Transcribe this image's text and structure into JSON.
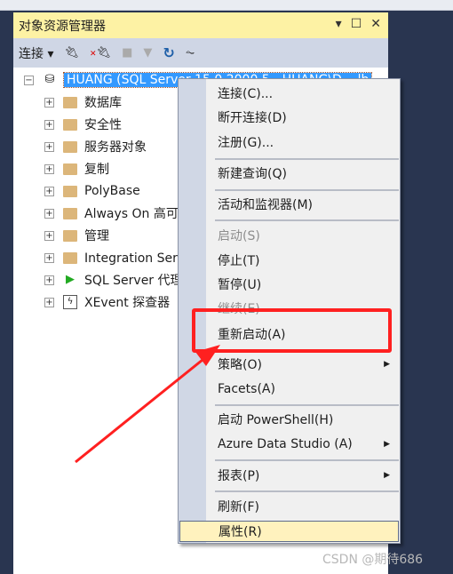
{
  "panel": {
    "title": "对象资源管理器",
    "controls": [
      "▾",
      "☐",
      "✕"
    ]
  },
  "toolbar": {
    "connect_label": "连接",
    "icons": [
      "plug-icon",
      "disconnect-icon",
      "stop-icon",
      "filter-icon",
      "refresh-icon",
      "activity-icon"
    ]
  },
  "tree": {
    "server": "HUANG (SQL Server 15.0.2000.5 - HUANG\\D",
    "server_tail": "lb",
    "items": [
      "数据库",
      "安全性",
      "服务器对象",
      "复制",
      "PolyBase",
      "Always On 高可用性",
      "管理",
      "Integration Services 目录",
      "SQL Server 代理",
      "XEvent 探查器"
    ]
  },
  "menu": {
    "items": [
      {
        "label": "连接(C)..."
      },
      {
        "label": "断开连接(D)"
      },
      {
        "label": "注册(G)..."
      },
      {
        "label": "新建查询(Q)"
      },
      {
        "label": "活动和监视器(M)"
      },
      {
        "label": "启动(S)",
        "disabled": true
      },
      {
        "label": "停止(T)"
      },
      {
        "label": "暂停(U)"
      },
      {
        "label": "继续(E)",
        "disabled": true
      },
      {
        "label": "重新启动(A)"
      },
      {
        "label": "策略(O)",
        "submenu": true
      },
      {
        "label": "Facets(A)"
      },
      {
        "label": "启动 PowerShell(H)"
      },
      {
        "label": "Azure Data Studio (A)",
        "submenu": true
      },
      {
        "label": "报表(P)",
        "submenu": true
      },
      {
        "label": "刷新(F)"
      },
      {
        "label": "属性(R)",
        "highlighted": true
      }
    ]
  },
  "annotation_color": "#ff2020",
  "watermark": "CSDN @期待686"
}
